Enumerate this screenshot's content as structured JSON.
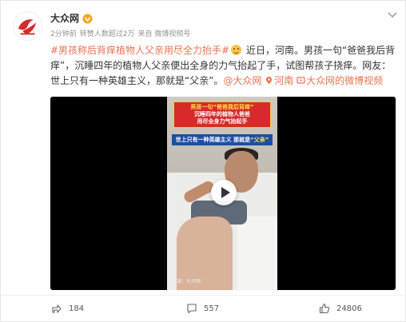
{
  "post": {
    "author": "大众网",
    "meta": {
      "time": "2分钟前",
      "reposts": "转赞人数超过2万",
      "source": "来自 微博视频号"
    },
    "text": {
      "topic": "#男孩称后背痒植物人父亲用尽全力抬手#",
      "body": " 近日，河南。男孩一句“爸爸我后背痒”，沉睡四年的植物人父亲便出全身的力气抬起了手，试图帮孩子挠痒。网友：世上只有一种英雄主义，那就是“父亲”。",
      "mention": "@大众网",
      "location": "河南",
      "video_link": "大众网的微博视频"
    },
    "video": {
      "caption_line1": "男孩一句“爸爸我后背痒”",
      "caption_line2": "沉睡四年的植物人爸爸",
      "caption_line3": "用尽全身力气抬起手",
      "caption_blue_prefix": "世上只有一种英雄主义  那就是",
      "caption_blue_highlight": "“父亲”",
      "watermark": "来源：大众网"
    },
    "actions": {
      "share_count": "184",
      "comment_count": "557",
      "like_count": "24806"
    },
    "icons": {
      "avatar": "dazhong-logo",
      "vip": "vip-badge-icon",
      "more": "chevron-down-icon",
      "share": "share-icon",
      "comment": "comment-icon",
      "like": "like-icon",
      "location": "location-pin-icon",
      "video": "video-icon"
    },
    "colors": {
      "link": "#eb7350",
      "caption_red": "#d8292b",
      "caption_blue": "#1d4ea6"
    }
  }
}
